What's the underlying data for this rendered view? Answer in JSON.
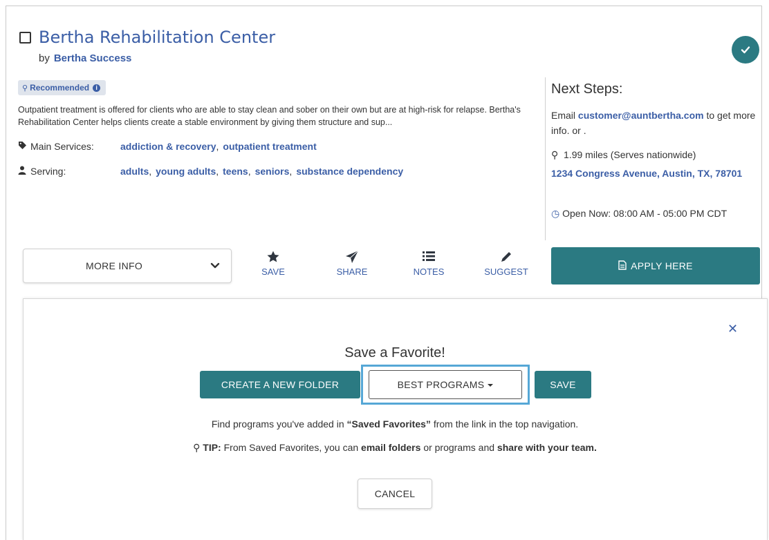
{
  "program": {
    "title": "Bertha Rehabilitation Center",
    "by_label": "by",
    "organization": "Bertha Success",
    "badge": "Recommended",
    "description": "Outpatient treatment is offered for clients who are able to stay clean and sober on their own but are at high-risk for relapse. Bertha's Rehabilitation Center helps clients create a stable environment by giving them structure and sup...",
    "main_services_label": "Main Services:",
    "main_services": [
      "addiction & recovery",
      "outpatient treatment"
    ],
    "serving_label": "Serving:",
    "serving": [
      "adults",
      "young adults",
      "teens",
      "seniors",
      "substance dependency"
    ]
  },
  "next_steps": {
    "title": "Next Steps:",
    "email_prefix": "Email",
    "email": "customer@auntbertha.com",
    "email_suffix": "to get more info. or .",
    "distance": "1.99 miles (Serves nationwide)",
    "address": "1234 Congress Avenue, Austin, TX, 78701",
    "hours": "Open Now: 08:00 AM - 05:00 PM CDT"
  },
  "actions": {
    "more_info": "MORE INFO",
    "save": "SAVE",
    "share": "SHARE",
    "notes": "NOTES",
    "suggest": "SUGGEST",
    "apply": "APPLY HERE"
  },
  "favorite_panel": {
    "title": "Save a Favorite!",
    "create_folder": "CREATE A NEW FOLDER",
    "folder_selected": "BEST PROGRAMS",
    "save": "SAVE",
    "find_prefix": "Find programs you've added in",
    "find_bold": "“Saved Favorites”",
    "find_suffix": "from the link in the top navigation.",
    "tip_label": "TIP:",
    "tip_text1": "From Saved Favorites, you can",
    "tip_bold1": "email folders",
    "tip_text2": "or programs and",
    "tip_bold2": "share with your team.",
    "cancel": "CANCEL"
  },
  "colors": {
    "teal": "#2b7a82",
    "link_blue": "#3b5ea6",
    "highlight": "#55a7d6"
  }
}
